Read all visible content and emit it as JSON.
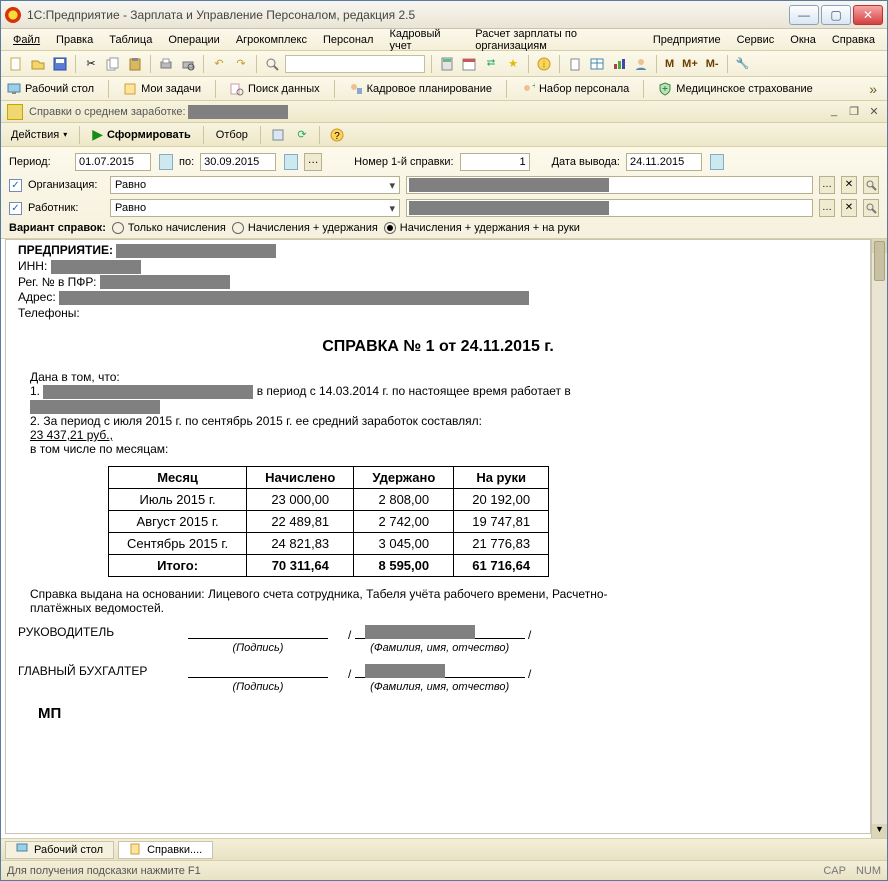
{
  "window": {
    "title": "1С:Предприятие - Зарплата и Управление Персоналом, редакция 2.5"
  },
  "menu": {
    "file": "Файл",
    "edit": "Правка",
    "table": "Таблица",
    "operations": "Операции",
    "agrocomplex": "Агрокомплекс",
    "staff": "Персонал",
    "hr": "Кадровый учет",
    "payroll": "Расчет зарплаты по организациям",
    "enterprise": "Предприятие",
    "service": "Сервис",
    "windows": "Окна",
    "help": "Справка"
  },
  "nav": {
    "desktop": "Рабочий стол",
    "mytasks": "Мои задачи",
    "search": "Поиск данных",
    "planning": "Кадровое планирование",
    "hiring": "Набор персонала",
    "medins": "Медицинское страхование"
  },
  "subwin": {
    "title": "Справки о среднем заработке:"
  },
  "actions": {
    "actions": "Действия",
    "generate": "Сформировать",
    "filter": "Отбор"
  },
  "filters": {
    "period_label": "Период:",
    "period_from": "01.07.2015",
    "period_to": "30.09.2015",
    "po": "по:",
    "first_cert_no_label": "Номер 1-й справки:",
    "first_cert_no": "1",
    "print_date_label": "Дата вывода:",
    "print_date": "24.11.2015",
    "org_label": "Организация:",
    "emp_label": "Работник:",
    "equals": "Равно",
    "variant_label": "Вариант справок:",
    "opt_accr": "Только начисления",
    "opt_accr_ded": "Начисления + удержания",
    "opt_full": "Начисления + удержания + на руки"
  },
  "doc": {
    "pred": "ПРЕДПРИЯТИЕ:",
    "inn": "ИНН:",
    "pfr": "Рег. № в ПФР:",
    "addr": "Адрес:",
    "tel": "Телефоны:",
    "title": "СПРАВКА № 1 от 24.11.2015 г.",
    "intro": "Дана в том, что:",
    "p1a": "1.",
    "p1b": "в период с 14.03.2014 г. по настоящее время работает в",
    "p2": "2. За период с июля 2015  г. по сентябрь 2015  г.  ее средний заработок составлял:",
    "amount": "23 437,21 руб.,",
    "bymonth": "в том числе по месяцам:",
    "th_month": "Месяц",
    "th_accr": "Начислено",
    "th_ded": "Удержано",
    "th_net": "На руки",
    "rows": [
      {
        "m": "Июль 2015 г.",
        "a": "23 000,00",
        "d": "2 808,00",
        "n": "20 192,00"
      },
      {
        "m": "Август 2015 г.",
        "a": "22 489,81",
        "d": "2 742,00",
        "n": "19 747,81"
      },
      {
        "m": "Сентябрь 2015 г.",
        "a": "24 821,83",
        "d": "3 045,00",
        "n": "21 776,83"
      }
    ],
    "total_label": "Итого:",
    "total": {
      "a": "70 311,64",
      "d": "8 595,00",
      "n": "61 716,64"
    },
    "basis": "Справка выдана на основании: Лицевого счета сотрудника, Табеля учёта рабочего времени, Расчетно-платёжных ведомостей.",
    "role_head": "РУКОВОДИТЕЛЬ",
    "role_acc": "ГЛАВНЫЙ БУХГАЛТЕР",
    "sig_hint1": "(Подпись)",
    "sig_hint2": "(Фамилия, имя, отчество)",
    "mp": "МП"
  },
  "dock": {
    "tab_desktop": "Рабочий стол",
    "tab_doc": "Справки...."
  },
  "status": {
    "hint": "Для получения подсказки нажмите F1",
    "cap": "CAP",
    "num": "NUM"
  }
}
